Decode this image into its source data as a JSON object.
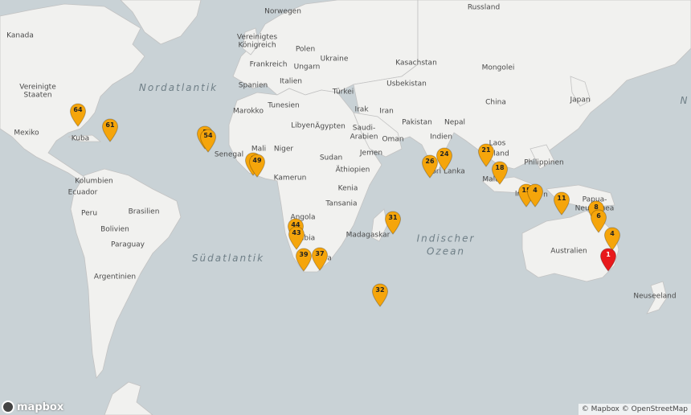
{
  "oceans": [
    {
      "id": "nordatlantik",
      "label": "Nordatlantik"
    },
    {
      "id": "suedatlantik",
      "label": "Südatlantik"
    },
    {
      "id": "indischer",
      "label": "Indischer\nOzean"
    },
    {
      "id": "edge-n",
      "label": "N"
    }
  ],
  "countries": [
    {
      "id": "russland",
      "label": "Russland"
    },
    {
      "id": "norwegen",
      "label": "Norwegen"
    },
    {
      "id": "kanada",
      "label": "Kanada"
    },
    {
      "id": "vereinigtes-koenigreich-1",
      "label": "Vereinigtes"
    },
    {
      "id": "vereinigtes-koenigreich-2",
      "label": "Königreich"
    },
    {
      "id": "polen",
      "label": "Polen"
    },
    {
      "id": "frankreich",
      "label": "Frankreich"
    },
    {
      "id": "ukraine",
      "label": "Ukraine"
    },
    {
      "id": "kasachstan",
      "label": "Kasachstan"
    },
    {
      "id": "ungarn",
      "label": "Ungarn"
    },
    {
      "id": "mongolei",
      "label": "Mongolei"
    },
    {
      "id": "spanien",
      "label": "Spanien"
    },
    {
      "id": "italien",
      "label": "Italien"
    },
    {
      "id": "usbekistan",
      "label": "Usbekistan"
    },
    {
      "id": "japan",
      "label": "Japan"
    },
    {
      "id": "vereinigte-staaten-1",
      "label": "Vereinigte"
    },
    {
      "id": "vereinigte-staaten-2",
      "label": "Staaten"
    },
    {
      "id": "tuerkei",
      "label": "Türkei"
    },
    {
      "id": "china",
      "label": "China"
    },
    {
      "id": "marokko",
      "label": "Marokko"
    },
    {
      "id": "tunesien",
      "label": "Tunesien"
    },
    {
      "id": "irak",
      "label": "Irak"
    },
    {
      "id": "iran",
      "label": "Iran"
    },
    {
      "id": "libyen",
      "label": "Libyen"
    },
    {
      "id": "aegypten",
      "label": "Ägypten"
    },
    {
      "id": "pakistan",
      "label": "Pakistan"
    },
    {
      "id": "nepal",
      "label": "Nepal"
    },
    {
      "id": "mexiko",
      "label": "Mexiko"
    },
    {
      "id": "saudi-1",
      "label": "Saudi-"
    },
    {
      "id": "saudi-2",
      "label": "Arabien"
    },
    {
      "id": "kuba",
      "label": "Kuba"
    },
    {
      "id": "indien",
      "label": "Indien"
    },
    {
      "id": "oman",
      "label": "Oman"
    },
    {
      "id": "laos",
      "label": "Laos"
    },
    {
      "id": "mali",
      "label": "Mali"
    },
    {
      "id": "niger",
      "label": "Niger"
    },
    {
      "id": "senegal",
      "label": "Senegal"
    },
    {
      "id": "sudan",
      "label": "Sudan"
    },
    {
      "id": "jemen",
      "label": "Jemen"
    },
    {
      "id": "thailand",
      "label": "land"
    },
    {
      "id": "philippinen",
      "label": "Philippinen"
    },
    {
      "id": "aethiopien",
      "label": "Äthiopien"
    },
    {
      "id": "sri-lanka",
      "label": "Sri Lanka"
    },
    {
      "id": "kolumbien",
      "label": "Kolumbien"
    },
    {
      "id": "kamerun",
      "label": "Kamerun"
    },
    {
      "id": "malaysia",
      "label": "Mala"
    },
    {
      "id": "ecuador",
      "label": "Ecuador"
    },
    {
      "id": "kenia",
      "label": "Kenia"
    },
    {
      "id": "indonesien",
      "label": "In"
    },
    {
      "id": "indonesien-2",
      "label": "n"
    },
    {
      "id": "papua-1",
      "label": "Papua-"
    },
    {
      "id": "papua-2",
      "label": "Neuguinea"
    },
    {
      "id": "tansania",
      "label": "Tansania"
    },
    {
      "id": "peru",
      "label": "Peru"
    },
    {
      "id": "brasilien",
      "label": "Brasilien"
    },
    {
      "id": "angola",
      "label": "Angola"
    },
    {
      "id": "bolivien",
      "label": "Bolivien"
    },
    {
      "id": "madagaskar",
      "label": "Madagaskar"
    },
    {
      "id": "paraguay",
      "label": "Paraguay"
    },
    {
      "id": "australien",
      "label": "Australien"
    },
    {
      "id": "namibia",
      "label": "ibia"
    },
    {
      "id": "suedafrika",
      "label": "a"
    },
    {
      "id": "argentinien",
      "label": "Argentinien"
    },
    {
      "id": "neuseeland",
      "label": "Neuseeland"
    }
  ],
  "markers": [
    {
      "label": "64",
      "color": "#f5a50b"
    },
    {
      "label": "61",
      "color": "#f5a50b"
    },
    {
      "label": "5",
      "color": "#f5a50b"
    },
    {
      "label": "54",
      "color": "#f5a50b"
    },
    {
      "label": "5",
      "color": "#f5a50b"
    },
    {
      "label": "49",
      "color": "#f5a50b"
    },
    {
      "label": "26",
      "color": "#f5a50b"
    },
    {
      "label": "24",
      "color": "#f5a50b"
    },
    {
      "label": "21",
      "color": "#f5a50b"
    },
    {
      "label": "18",
      "color": "#f5a50b"
    },
    {
      "label": "15",
      "color": "#f5a50b"
    },
    {
      "label": "4",
      "color": "#f5a50b"
    },
    {
      "label": "11",
      "color": "#f5a50b"
    },
    {
      "label": "8",
      "color": "#f5a50b"
    },
    {
      "label": "6",
      "color": "#f5a50b"
    },
    {
      "label": "4",
      "color": "#f5a50b"
    },
    {
      "label": "1",
      "color": "#e8191c"
    },
    {
      "label": "31",
      "color": "#f5a50b"
    },
    {
      "label": "44",
      "color": "#f5a50b"
    },
    {
      "label": "43",
      "color": "#f5a50b"
    },
    {
      "label": "39",
      "color": "#f5a50b"
    },
    {
      "label": "37",
      "color": "#f5a50b"
    },
    {
      "label": "32",
      "color": "#f5a50b"
    }
  ],
  "colors": {
    "water": "#c9d2d6",
    "land": "#f1f1ef",
    "border": "#c2c2c2",
    "marker": "#f5a50b",
    "marker_selected": "#e8191c"
  },
  "logo": {
    "text": "mapbox"
  },
  "attribution": {
    "mapbox": "© Mapbox",
    "osm": "© OpenStreetMap"
  }
}
